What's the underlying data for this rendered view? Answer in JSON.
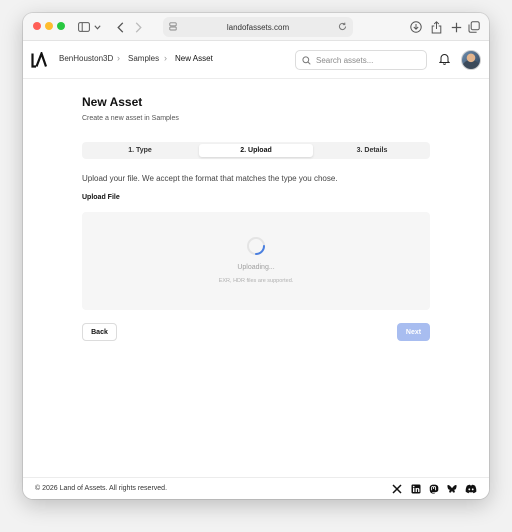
{
  "browser": {
    "url": "landofassets.com"
  },
  "header": {
    "breadcrumbs": [
      "BenHouston3D",
      "Samples",
      "New Asset"
    ],
    "search_placeholder": "Search assets..."
  },
  "main": {
    "title": "New Asset",
    "subtitle": "Create a new asset in Samples",
    "steps": [
      {
        "label": "1. Type",
        "active": false
      },
      {
        "label": "2. Upload",
        "active": true
      },
      {
        "label": "3. Details",
        "active": false
      }
    ],
    "instructions": "Upload your file. We accept the format that matches the type you chose.",
    "upload_label": "Upload File",
    "upload_status": "Uploading...",
    "upload_hint": "EXR, HDR files are supported.",
    "back_label": "Back",
    "next_label": "Next"
  },
  "footer": {
    "copyright": "© 2026 Land of Assets. All rights reserved.",
    "social_icons": [
      "x-icon",
      "linkedin-icon",
      "mastodon-icon",
      "bluesky-icon",
      "discord-icon"
    ]
  },
  "colors": {
    "next_disabled": "#a8bdf0",
    "spinner": "#4a7fe0"
  }
}
